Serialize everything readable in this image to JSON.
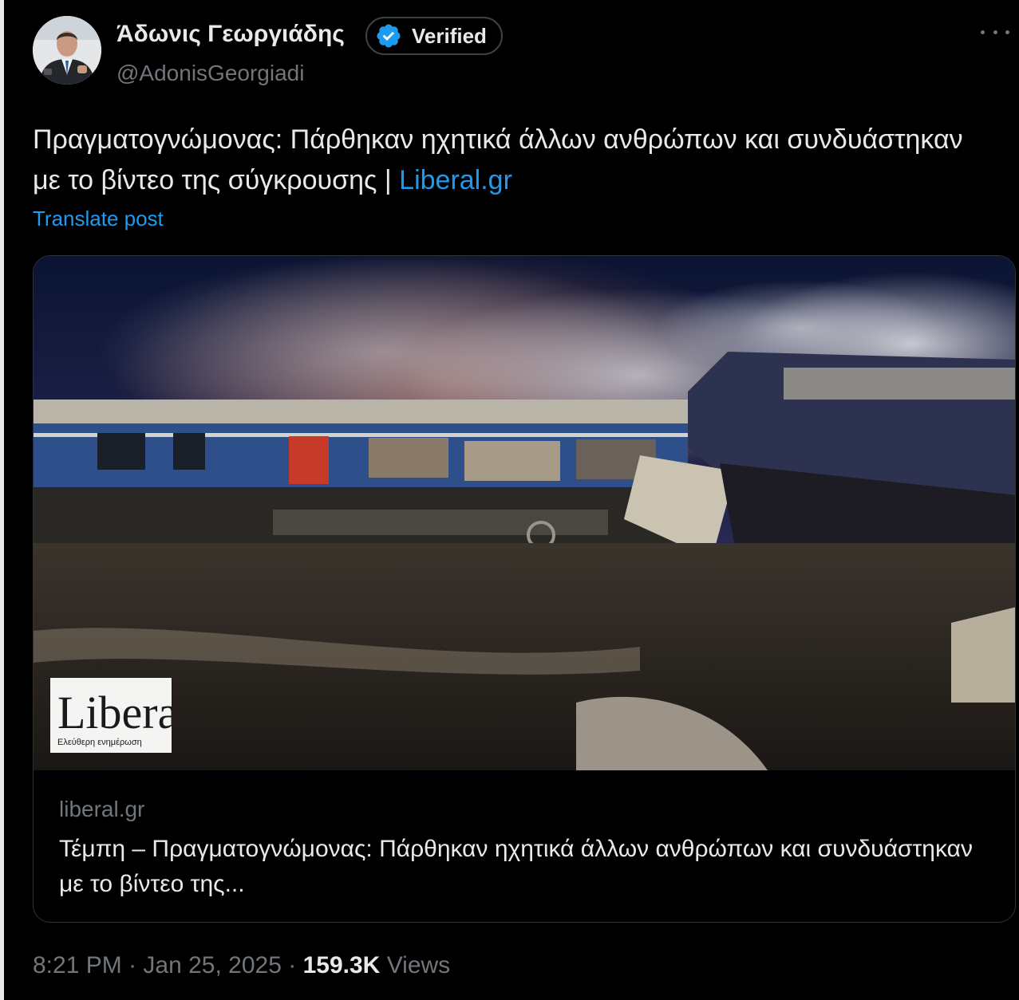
{
  "author": {
    "display_name": "Άδωνις Γεωργιάδης",
    "handle": "@AdonisGeorgiadi",
    "verified_label": "Verified",
    "avatar_icon": "user-avatar"
  },
  "post": {
    "text": "Πραγματογνώμονας: Πάρθηκαν ηχητικά άλλων ανθρώπων και συνδυάστηκαν με το βίντεο της σύγκρουσης | ",
    "link_text": "Liberal.gr",
    "translate_label": "Translate post"
  },
  "card": {
    "image_logo_text": "Liberal",
    "image_logo_tagline": "Ελεύθερη ενημέρωση",
    "domain": "liberal.gr",
    "title": "Τέμπη – Πραγματογνώμονας: Πάρθηκαν ηχητικά άλλων ανθρώπων και συνδυάστηκαν με το βίντεο της..."
  },
  "meta": {
    "time": "8:21 PM",
    "separator": "·",
    "date": "Jan 25, 2025",
    "views_count": "159.3K",
    "views_label": "Views"
  },
  "colors": {
    "background": "#000000",
    "text": "#e7e9ea",
    "secondary": "#71767b",
    "accent": "#1d9bf0",
    "border": "#2f3336"
  },
  "icons": [
    "more-icon",
    "verified-badge-icon"
  ]
}
